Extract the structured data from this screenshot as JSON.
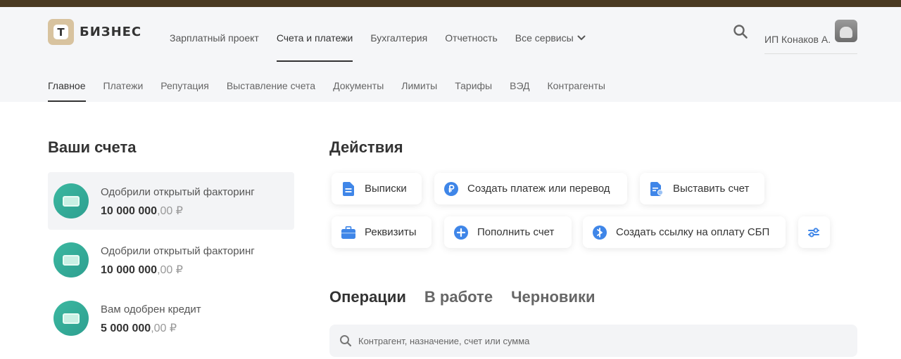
{
  "brand": {
    "logo_letter": "Т",
    "name": "БИЗНЕС"
  },
  "top_nav": [
    {
      "label": "Зарплатный проект"
    },
    {
      "label": "Счета и платежи",
      "active": true
    },
    {
      "label": "Бухгалтерия"
    },
    {
      "label": "Отчетность"
    },
    {
      "label": "Все сервисы"
    }
  ],
  "user": {
    "name": "ИП Конаков А."
  },
  "sub_nav": [
    {
      "label": "Главное",
      "active": true
    },
    {
      "label": "Платежи"
    },
    {
      "label": "Репутация"
    },
    {
      "label": "Выставление счета"
    },
    {
      "label": "Документы"
    },
    {
      "label": "Лимиты"
    },
    {
      "label": "Тарифы"
    },
    {
      "label": "ВЭД"
    },
    {
      "label": "Контрагенты"
    }
  ],
  "accounts": {
    "title": "Ваши счета",
    "items": [
      {
        "title": "Одобрили открытый факторинг",
        "amount_int": "10 000 000",
        "amount_dec": ",00 ₽",
        "selected": true
      },
      {
        "title": "Одобрили открытый факторинг",
        "amount_int": "10 000 000",
        "amount_dec": ",00 ₽"
      },
      {
        "title": "Вам одобрен кредит",
        "amount_int": "5 000 000",
        "amount_dec": ",00 ₽"
      }
    ]
  },
  "actions": {
    "title": "Действия",
    "items": [
      {
        "label": "Выписки",
        "icon": "document-icon"
      },
      {
        "label": "Создать платеж или перевод",
        "icon": "ruble-icon"
      },
      {
        "label": "Выставить счет",
        "icon": "invoice-icon"
      },
      {
        "label": "Реквизиты",
        "icon": "briefcase-icon"
      },
      {
        "label": "Пополнить счет",
        "icon": "plus-icon"
      },
      {
        "label": "Создать ссылку на оплату СБП",
        "icon": "sbp-icon"
      },
      {
        "label": "",
        "icon": "settings-sliders-icon"
      }
    ]
  },
  "operations": {
    "tabs": [
      {
        "label": "Операции",
        "active": true
      },
      {
        "label": "В работе"
      },
      {
        "label": "Черновики"
      }
    ],
    "search_placeholder": "Контрагент, назначение, счет или сумма"
  },
  "colors": {
    "accent_blue": "#3f86e8",
    "account_icon_green": "#3bb8a0",
    "header_bg": "#f5f6f8",
    "top_strip": "#4a3a22"
  }
}
